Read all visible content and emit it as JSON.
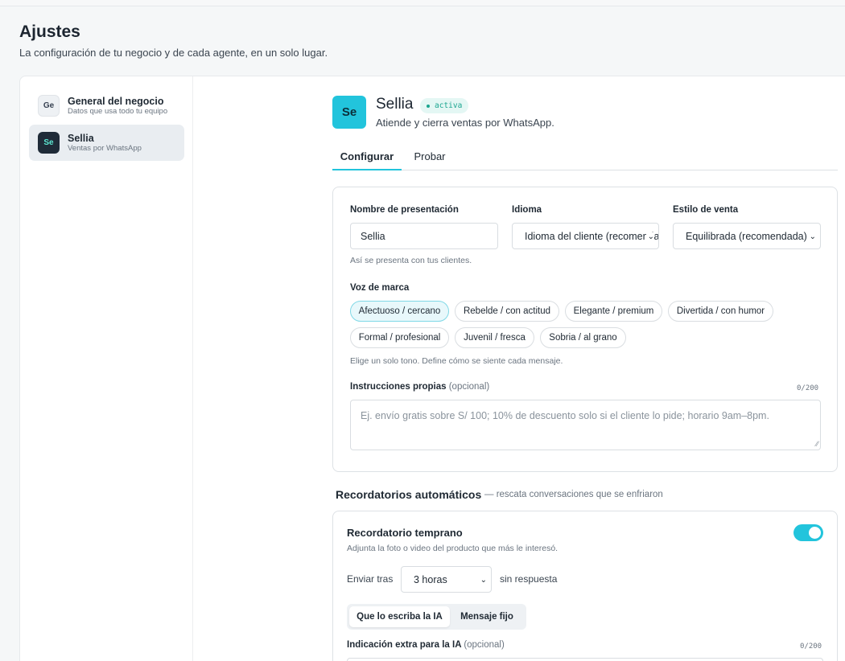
{
  "page": {
    "title": "Ajustes",
    "subtitle": "La configuración de tu negocio y de cada agente, en un solo lugar."
  },
  "sidebar": {
    "items": [
      {
        "avatar": "Ge",
        "title": "General del negocio",
        "subtitle": "Datos que usa todo tu equipo",
        "active": false
      },
      {
        "avatar": "Se",
        "title": "Sellia",
        "subtitle": "Ventas por WhatsApp",
        "active": true
      }
    ]
  },
  "agent": {
    "avatar": "Se",
    "name": "Sellia",
    "status": "activa",
    "description": "Atiende y cierra ventas por WhatsApp."
  },
  "tabs": [
    {
      "label": "Configurar",
      "active": true
    },
    {
      "label": "Probar",
      "active": false
    }
  ],
  "form": {
    "name_label": "Nombre de presentación",
    "name_value": "Sellia",
    "name_hint": "Así se presenta con tus clientes.",
    "language_label": "Idioma",
    "language_value": "Idioma del cliente (recomendado)",
    "style_label": "Estilo de venta",
    "style_value": "Equilibrada (recomendada)",
    "voice_label": "Voz de marca",
    "voice_options": [
      {
        "label": "Afectuoso / cercano",
        "selected": true
      },
      {
        "label": "Rebelde / con actitud",
        "selected": false
      },
      {
        "label": "Elegante / premium",
        "selected": false
      },
      {
        "label": "Divertida / con humor",
        "selected": false
      },
      {
        "label": "Formal / profesional",
        "selected": false
      },
      {
        "label": "Juvenil / fresca",
        "selected": false
      },
      {
        "label": "Sobria / al grano",
        "selected": false
      }
    ],
    "voice_hint": "Elige un solo tono. Define cómo se siente cada mensaje.",
    "instructions_label": "Instrucciones propias",
    "instructions_optional": "(opcional)",
    "instructions_counter": "0/200",
    "instructions_placeholder": "Ej. envío gratis sobre S/ 100; 10% de descuento solo si el cliente lo pide; horario 9am–8pm."
  },
  "reminders": {
    "section_title": "Recordatorios automáticos",
    "section_note": "— rescata conversaciones que se enfriaron",
    "early": {
      "title": "Recordatorio temprano",
      "subtitle": "Adjunta la foto o video del producto que más le interesó.",
      "enabled": true,
      "send_after_label": "Enviar tras",
      "delay_value": "3 horas",
      "no_reply_label": "sin respuesta",
      "mode_options": [
        {
          "label": "Que lo escriba la IA",
          "active": true
        },
        {
          "label": "Mensaje fijo",
          "active": false
        }
      ],
      "extra_label": "Indicación extra para la IA",
      "extra_optional": "(opcional)",
      "extra_counter": "0/200"
    }
  },
  "colors": {
    "accent": "#22c4dc",
    "status_green": "#1aa58f",
    "dark_avatar": "#1f2b38"
  },
  "icons": {
    "chevron": "chevron-down-icon",
    "resize": "resize-handle-icon"
  }
}
